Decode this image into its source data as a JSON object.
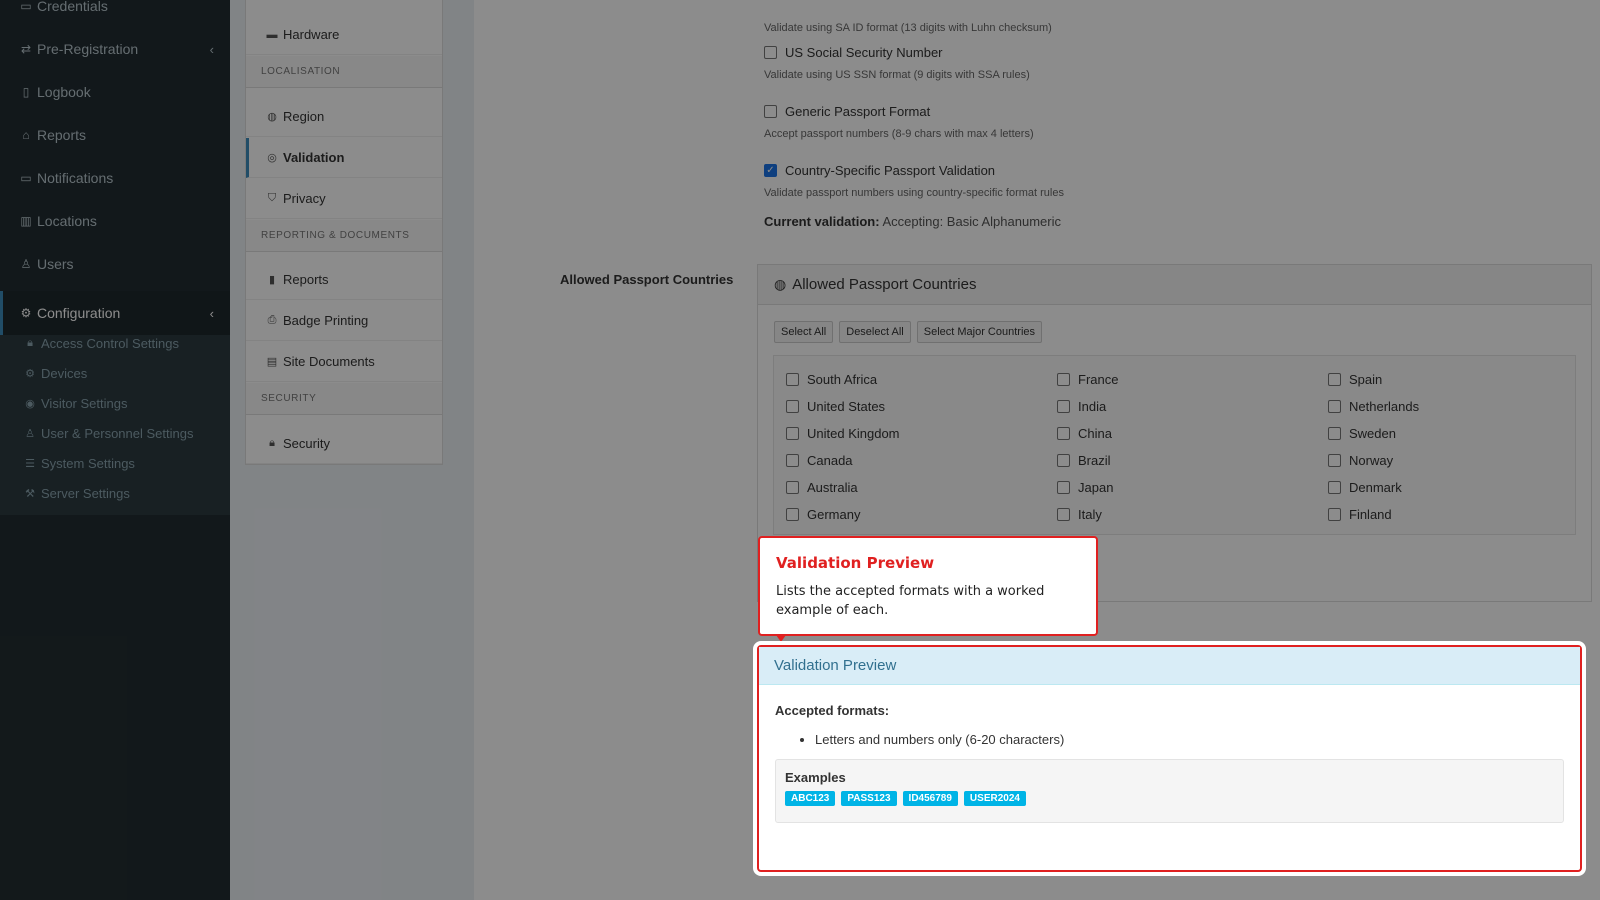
{
  "sidebar": {
    "items": [
      {
        "label": "Credentials",
        "icon": "id-card-icon"
      },
      {
        "label": "Pre-Registration",
        "icon": "exchange-icon",
        "chevron": "‹"
      },
      {
        "label": "Logbook",
        "icon": "book-icon"
      },
      {
        "label": "Reports",
        "icon": "chart-icon"
      },
      {
        "label": "Notifications",
        "icon": "message-icon"
      },
      {
        "label": "Locations",
        "icon": "building-icon"
      },
      {
        "label": "Users",
        "icon": "users-icon"
      },
      {
        "label": "Configuration",
        "icon": "cogs-icon",
        "chevron": "‹"
      }
    ],
    "submenu": [
      {
        "label": "Access Control Settings",
        "icon": "lock-icon"
      },
      {
        "label": "Devices",
        "icon": "gear-icon"
      },
      {
        "label": "Visitor Settings",
        "icon": "eye-icon"
      },
      {
        "label": "User & Personnel Settings",
        "icon": "users-icon"
      },
      {
        "label": "System Settings",
        "icon": "sliders-icon"
      },
      {
        "label": "Server Settings",
        "icon": "server-icon"
      }
    ]
  },
  "settings_nav": {
    "hardware": "Hardware",
    "section_localisation": "LOCALISATION",
    "region": "Region",
    "validation": "Validation",
    "privacy": "Privacy",
    "section_reporting": "REPORTING & DOCUMENTS",
    "reports": "Reports",
    "badge_printing": "Badge Printing",
    "site_documents": "Site Documents",
    "section_security": "SECURITY",
    "security": "Security"
  },
  "validation_options": {
    "sa_id_help": "Validate using SA ID format (13 digits with Luhn checksum)",
    "us_ssn_label": "US Social Security Number",
    "us_ssn_help": "Validate using US SSN format (9 digits with SSA rules)",
    "generic_passport_label": "Generic Passport Format",
    "generic_passport_help": "Accept passport numbers (8-9 chars with max 4 letters)",
    "country_passport_label": "Country-Specific Passport Validation",
    "country_passport_help": "Validate passport numbers using country-specific format rules",
    "country_passport_checked": true,
    "current_validation_label": "Current validation:",
    "current_validation_value": "Accepting: Basic Alphanumeric"
  },
  "allowed_countries": {
    "field_label": "Allowed Passport Countries",
    "panel_title": "Allowed Passport Countries",
    "buttons": {
      "select_all": "Select All",
      "deselect_all": "Deselect All",
      "select_major": "Select Major Countries"
    },
    "countries": [
      [
        "South Africa",
        "France",
        "Spain"
      ],
      [
        "United States",
        "India",
        "Netherlands"
      ],
      [
        "United Kingdom",
        "China",
        "Sweden"
      ],
      [
        "Canada",
        "Brazil",
        "Norway"
      ],
      [
        "Australia",
        "Japan",
        "Denmark"
      ],
      [
        "Germany",
        "Italy",
        "Finland"
      ]
    ]
  },
  "callout": {
    "title": "Validation Preview",
    "text": "Lists the accepted formats with a worked example of each."
  },
  "preview": {
    "title": "Validation Preview",
    "accepted_label": "Accepted formats:",
    "formats": [
      "Letters and numbers only (6-20 characters)"
    ],
    "examples_label": "Examples",
    "examples": [
      "ABC123",
      "PASS123",
      "ID456789",
      "USER2024"
    ]
  },
  "colors": {
    "sidebar_bg": "#222d32",
    "accent": "#3c8dbc",
    "highlight": "#e02020",
    "tag": "#00b4e6"
  }
}
